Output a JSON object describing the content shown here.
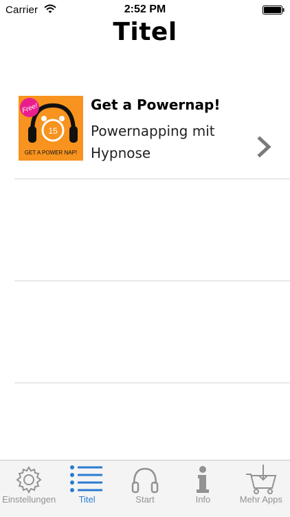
{
  "status_bar": {
    "carrier": "Carrier",
    "time": "2:52 PM"
  },
  "nav": {
    "title": "Titel"
  },
  "list": {
    "items": [
      {
        "title": "Get a Powernap!",
        "subtitle": "Powernapping mit Hypnose",
        "artwork": {
          "badge_text": "Free!",
          "caption": "GET A POWER NAP!",
          "clock_number": "15",
          "colors": {
            "background": "#f7931e",
            "badge": "#e91e8c"
          }
        }
      }
    ]
  },
  "tabbar": {
    "tabs": [
      {
        "label": "Einstellungen",
        "icon": "gear-icon",
        "active": false
      },
      {
        "label": "Titel",
        "icon": "list-icon",
        "active": true
      },
      {
        "label": "Start",
        "icon": "headphones-icon",
        "active": false
      },
      {
        "label": "Info",
        "icon": "info-icon",
        "active": false
      },
      {
        "label": "Mehr Apps",
        "icon": "cart-icon",
        "active": false
      }
    ]
  },
  "colors": {
    "accent": "#2a7bd1",
    "inactive_tab": "#929292",
    "separator": "#d6d6d6"
  }
}
